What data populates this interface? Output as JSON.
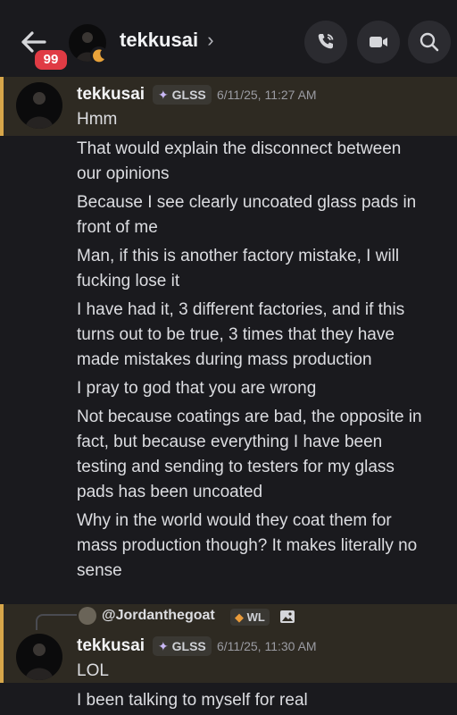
{
  "header": {
    "unread_count": "99",
    "channel_name": "tekkusai",
    "chevron": "›"
  },
  "messages": [
    {
      "author": "tekkusai",
      "tag": "GLSS",
      "timestamp": "6/11/25, 11:27 AM",
      "lines": [
        "Hmm",
        "That would explain the disconnect between",
        "our opinions",
        "Because I see clearly uncoated glass pads in",
        "front of me",
        "Man, if this is another factory mistake, I will",
        "fucking lose it",
        "I have had it, 3 different factories, and if this",
        "turns out to be true, 3 times that they have",
        "made mistakes during mass production",
        "I pray to god that you are wrong",
        "Not because coatings are bad, the opposite in",
        "fact, but because everything I have been",
        "testing and sending to testers for my glass",
        "pads has been uncoated",
        "Why in the world would they coat them for",
        "mass production though? It makes literally no",
        "sense"
      ]
    },
    {
      "reply_to": "@Jordanthegoat",
      "reply_tag": "WL",
      "author": "tekkusai",
      "tag": "GLSS",
      "timestamp": "6/11/25, 11:30 AM",
      "lines": [
        "LOL",
        "I been talking to myself for real"
      ]
    }
  ],
  "icons": {
    "back": "arrow-left-icon",
    "call": "phone-icon",
    "video": "video-camera-icon",
    "search": "search-icon",
    "tag": "sparkle-icon",
    "image": "image-icon"
  },
  "colors": {
    "background": "#1a1a1e",
    "highlight": "#2e2a22",
    "highlight_bar": "#d7a64a",
    "badge": "#e03b44"
  }
}
